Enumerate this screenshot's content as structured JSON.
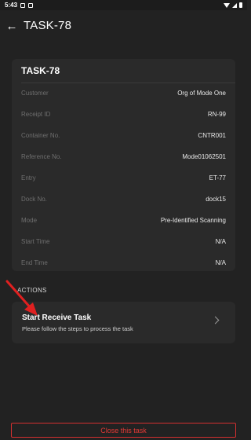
{
  "status_bar": {
    "time": "5:43",
    "icons": [
      "notification-icon",
      "notification-icon",
      "wifi-icon",
      "signal-icon",
      "battery-icon"
    ]
  },
  "header": {
    "back_icon": "←",
    "title": "TASK-78"
  },
  "details": {
    "title": "TASK-78",
    "rows": [
      {
        "label": "Customer",
        "value": "Org of Mode One"
      },
      {
        "label": "Receipt ID",
        "value": "RN-99"
      },
      {
        "label": "Container No.",
        "value": "CNTR001"
      },
      {
        "label": "Reference No.",
        "value": "Mode01062501"
      },
      {
        "label": "Entry",
        "value": "ET-77"
      },
      {
        "label": "Dock No.",
        "value": "dock15"
      },
      {
        "label": "Mode",
        "value": "Pre-Identified Scanning"
      },
      {
        "label": "Start Time",
        "value": "N/A"
      },
      {
        "label": "End Time",
        "value": "N/A"
      }
    ]
  },
  "actions": {
    "section_label": "ACTIONS",
    "items": [
      {
        "title": "Start Receive Task",
        "subtitle": "Please follow the steps to process the task"
      }
    ]
  },
  "footer": {
    "close_label": "Close this task"
  },
  "colors": {
    "background": "#222222",
    "card": "#2a2a2a",
    "danger": "#e53935",
    "annotation": "#e02020"
  }
}
